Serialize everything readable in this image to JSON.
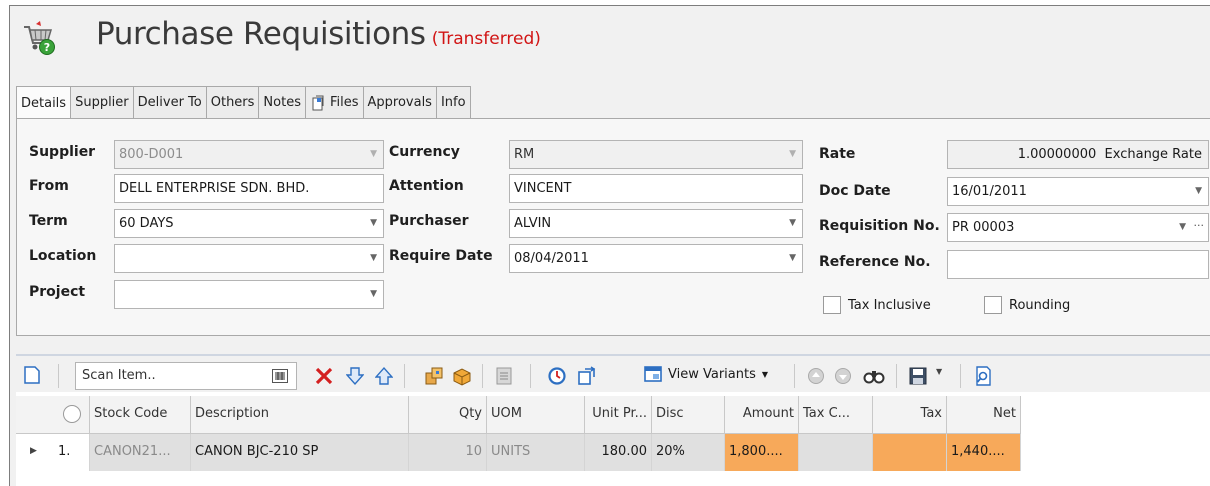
{
  "header": {
    "title": "Purchase Requisitions",
    "status": "(Transferred)",
    "icon": "shopping-cart-help-icon"
  },
  "tabs": [
    {
      "label": "Details"
    },
    {
      "label": "Supplier"
    },
    {
      "label": "Deliver To"
    },
    {
      "label": "Others"
    },
    {
      "label": "Notes"
    },
    {
      "label": "Files",
      "icon": "files-icon"
    },
    {
      "label": "Approvals"
    },
    {
      "label": "Info"
    }
  ],
  "form": {
    "supplier": {
      "label": "Supplier",
      "value": "800-D001"
    },
    "from": {
      "label": "From",
      "value": "DELL ENTERPRISE SDN. BHD."
    },
    "term": {
      "label": "Term",
      "value": "60 DAYS"
    },
    "location": {
      "label": "Location",
      "value": ""
    },
    "project": {
      "label": "Project",
      "value": ""
    },
    "currency": {
      "label": "Currency",
      "value": "RM"
    },
    "attention": {
      "label": "Attention",
      "value": "VINCENT"
    },
    "purchaser": {
      "label": "Purchaser",
      "value": "ALVIN"
    },
    "require_date": {
      "label": "Require Date",
      "value": "08/04/2011"
    },
    "rate": {
      "label": "Rate",
      "value": "1.00000000",
      "suffix": "Exchange Rate"
    },
    "doc_date": {
      "label": "Doc Date",
      "value": "16/01/2011"
    },
    "requisition_no": {
      "label": "Requisition No.",
      "value": "PR 00003"
    },
    "reference_no": {
      "label": "Reference No.",
      "value": ""
    },
    "tax_inclusive": {
      "label": "Tax Inclusive",
      "checked": false
    },
    "rounding": {
      "label": "Rounding",
      "checked": false
    }
  },
  "toolbar": {
    "scan_placeholder": "Scan Item..",
    "view_variants_label": "View Variants"
  },
  "grid": {
    "columns": [
      "Stock Code",
      "Description",
      "Qty",
      "UOM",
      "Unit Pr...",
      "Disc",
      "Amount",
      "Tax C...",
      "Tax",
      "Net"
    ],
    "rows": [
      {
        "no": "1.",
        "stock_code": "CANON21...",
        "description": "CANON BJC-210 SP",
        "qty": "10",
        "uom": "UNITS",
        "unit_price": "180.00",
        "disc": "20%",
        "amount": "1,800....",
        "tax_code": "",
        "tax": "",
        "net": "1,440...."
      }
    ]
  },
  "colors": {
    "status": "#d11414",
    "highlight": "#f7a95a",
    "accent_blue": "#2d6fc2"
  }
}
